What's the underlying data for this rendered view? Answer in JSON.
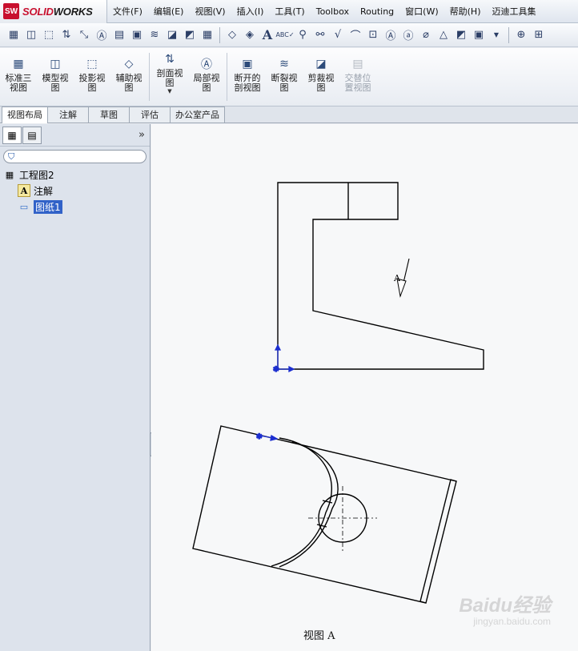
{
  "app": {
    "brand_sw": "SW",
    "brand_solid": "SOLID",
    "brand_works": "WORKS"
  },
  "menu": [
    "文件(F)",
    "编辑(E)",
    "视图(V)",
    "插入(I)",
    "工具(T)",
    "Toolbox",
    "Routing",
    "窗口(W)",
    "帮助(H)",
    "迈迪工具集"
  ],
  "toolbar_icons": [
    "standard-3-view-icon",
    "model-view-icon",
    "projected-view-icon",
    "auxiliary-view-icon",
    "section-view-icon",
    "detail-view-icon",
    "break-view-icon",
    "broken-out-section-icon",
    "crop-view-icon",
    "alternate-position-icon",
    "smart-dimension-icon",
    "model-items-icon",
    "note-icon",
    "spell-checker-icon",
    "balloon-icon",
    "auto-balloon-icon",
    "surface-finish-icon",
    "weld-symbol-icon",
    "hole-callout-icon",
    "geometric-tolerance-icon",
    "datum-feature-icon",
    "datum-target-icon",
    "hatch-fill-icon",
    "block-icon",
    "center-mark-icon"
  ],
  "commands": [
    {
      "label_line1": "标准三",
      "label_line2": "视图"
    },
    {
      "label_line1": "模型视",
      "label_line2": "图"
    },
    {
      "label_line1": "投影视",
      "label_line2": "图"
    },
    {
      "label_line1": "辅助视",
      "label_line2": "图"
    },
    {
      "label_line1": "剖面视",
      "label_line2": "图"
    },
    {
      "label_line1": "局部视",
      "label_line2": "图"
    },
    {
      "label_line1": "断开的",
      "label_line2": "剖视图"
    },
    {
      "label_line1": "断裂视",
      "label_line2": "图"
    },
    {
      "label_line1": "剪裁视",
      "label_line2": "图"
    },
    {
      "label_line1": "交替位",
      "label_line2": "置视图"
    }
  ],
  "tabs": [
    "视图布局",
    "注解",
    "草图",
    "评估",
    "办公室产品"
  ],
  "tree": {
    "root": "工程图2",
    "annotations": "注解",
    "sheet": "图纸1"
  },
  "drawing": {
    "section_letter": "A",
    "view_label": "视图 A"
  },
  "watermark": {
    "brand": "Baidu经验",
    "url": "jingyan.baidu.com"
  },
  "colors": {
    "accent": "#3162c8",
    "selection": "#3162c8",
    "brand_red": "#c8102e",
    "origin_blue": "#1c2fd0"
  }
}
